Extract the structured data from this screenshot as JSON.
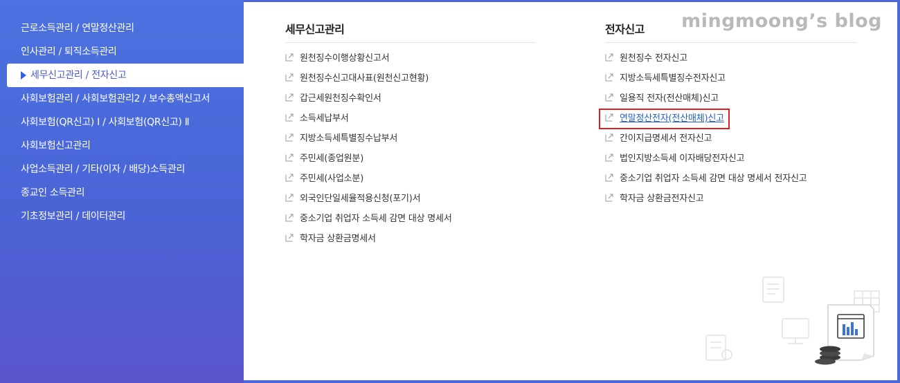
{
  "sidebar": {
    "items": [
      {
        "label": "근로소득관리 / 연말정산관리"
      },
      {
        "label": "인사관리 / 퇴직소득관리"
      },
      {
        "label": "세무신고관리 / 전자신고",
        "active": true
      },
      {
        "label": "사회보험관리 / 사회보험관리2 / 보수총액신고서"
      },
      {
        "label": "사회보험(QR신고) Ⅰ / 사회보험(QR신고) Ⅱ"
      },
      {
        "label": "사회보험신고관리"
      },
      {
        "label": "사업소득관리 / 기타(이자 / 배당)소득관리"
      },
      {
        "label": "종교인 소득관리"
      },
      {
        "label": "기초정보관리 / 데이터관리"
      }
    ]
  },
  "watermark": "mingmoong’s blog",
  "tax_column": {
    "title": "세무신고관리",
    "links": [
      "원천징수이행상황신고서",
      "원천징수신고대사표(원천신고현황)",
      "갑근세원천징수확인서",
      "소득세납부서",
      "지방소득세특별징수납부서",
      "주민세(종업원분)",
      "주민세(사업소분)",
      "외국인단일세율적용신청(포기)서",
      "중소기업 취업자 소득세 감면 대상 명세서",
      "학자금 상환금명세서"
    ]
  },
  "efile_column": {
    "title": "전자신고",
    "links": [
      "원천징수 전자신고",
      "지방소득세특별징수전자신고",
      "일용직 전자(전산매체)신고",
      "연말정산전자(전산매체)신고",
      "간이지급명세서 전자신고",
      "법인지방소득세 이자배당전자신고",
      "중소기업 취업자 소득세 감면 대상 명세서 전자신고",
      "학자금 상환금전자신고"
    ],
    "highlighted_index": 3
  },
  "colors": {
    "sidebar_bg": "#4a68d8",
    "active_text": "#4a5bd0",
    "highlight_border": "#e01e1e",
    "link_highlight": "#1f5fd0"
  },
  "icons": {
    "link": "external-link-icon",
    "active": "triangle-right-icon"
  }
}
